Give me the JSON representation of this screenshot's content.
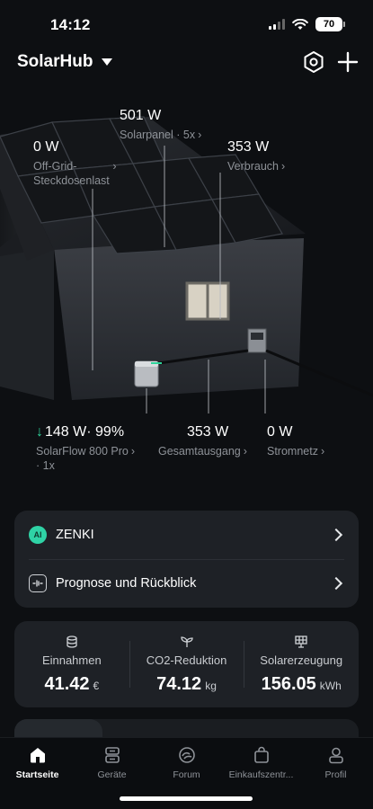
{
  "status": {
    "time": "14:12",
    "battery": "70"
  },
  "header": {
    "title": "SolarHub"
  },
  "hero": {
    "solar": {
      "value": "501 W",
      "label": "Solarpanel · 5x"
    },
    "offgrid": {
      "value": "0 W",
      "label_line1": "Off-Grid-",
      "label_line2": "Steckdosenlast"
    },
    "consumption": {
      "value": "353 W",
      "label": "Verbrauch"
    },
    "battery": {
      "value": "148 W· 99%",
      "label_line1": "SolarFlow 800 Pro",
      "label_line2": "· 1x"
    },
    "output": {
      "value": "353 W",
      "label": "Gesamtausgang"
    },
    "grid": {
      "value": "0 W",
      "label": "Stromnetz"
    }
  },
  "menu": {
    "zenki": {
      "badge": "AI",
      "label": "ZENKI"
    },
    "forecast": {
      "label": "Prognose und Rückblick"
    }
  },
  "stats": [
    {
      "label": "Einnahmen",
      "value": "41.42",
      "unit": "€"
    },
    {
      "label": "CO2-Reduktion",
      "value": "74.12",
      "unit": "kg"
    },
    {
      "label": "Solarerzeugung",
      "value": "156.05",
      "unit": "kWh"
    }
  ],
  "tabs": [
    {
      "label": "Startseite"
    },
    {
      "label": "Geräte"
    },
    {
      "label": "Forum"
    },
    {
      "label": "Einkaufszentr..."
    },
    {
      "label": "Profil"
    }
  ],
  "colors": {
    "accent": "#2fd39a",
    "card": "#1e2126",
    "background": "#0d0f12"
  }
}
